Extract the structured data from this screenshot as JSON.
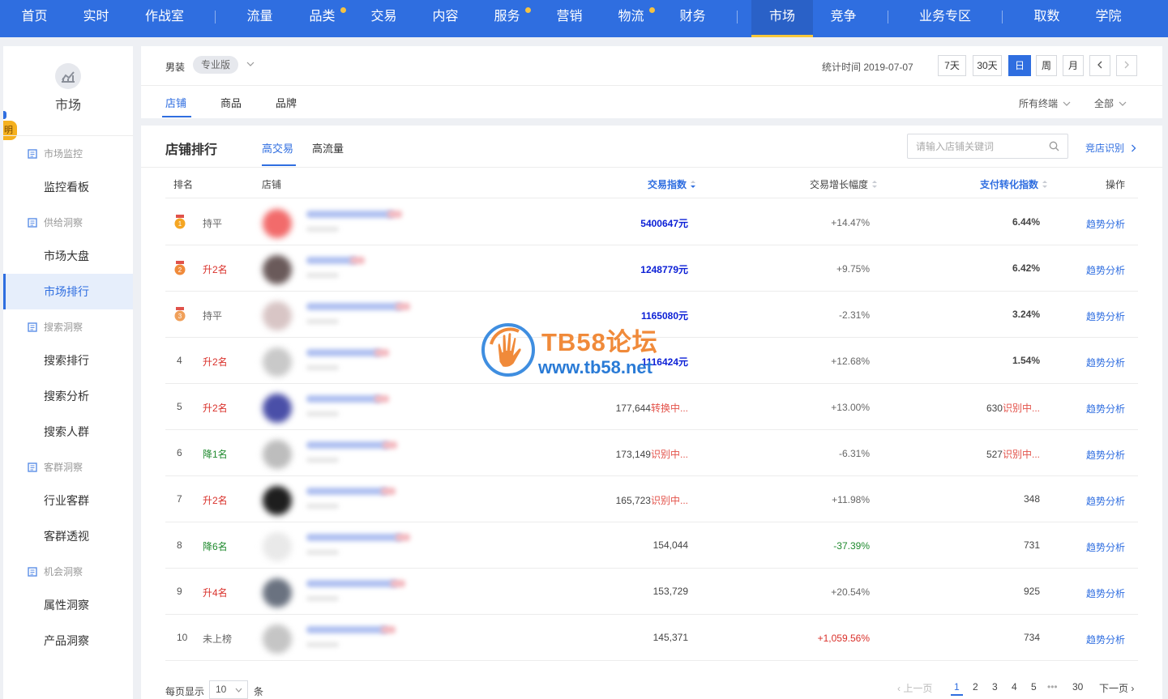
{
  "nav": {
    "items": [
      {
        "label": "首页",
        "dot": false
      },
      {
        "label": "实时",
        "dot": false
      },
      {
        "label": "作战室",
        "dot": false
      },
      {
        "label": "流量",
        "dot": false
      },
      {
        "label": "品类",
        "dot": true
      },
      {
        "label": "交易",
        "dot": false
      },
      {
        "label": "内容",
        "dot": false
      },
      {
        "label": "服务",
        "dot": true
      },
      {
        "label": "营销",
        "dot": false
      },
      {
        "label": "物流",
        "dot": true
      },
      {
        "label": "财务",
        "dot": false
      },
      {
        "label": "市场",
        "dot": false,
        "active": true
      },
      {
        "label": "竞争",
        "dot": false
      },
      {
        "label": "业务专区",
        "dot": false
      },
      {
        "label": "取数",
        "dot": false
      },
      {
        "label": "学院",
        "dot": false
      }
    ]
  },
  "sidebar": {
    "edge_tab": "明",
    "title": "市场",
    "groups": [
      {
        "label": "市场监控",
        "items": [
          "监控看板"
        ]
      },
      {
        "label": "供给洞察",
        "items": [
          "市场大盘",
          "市场排行"
        ]
      },
      {
        "label": "搜索洞察",
        "items": [
          "搜索排行",
          "搜索分析",
          "搜索人群"
        ]
      },
      {
        "label": "客群洞察",
        "items": [
          "行业客群",
          "客群透视"
        ]
      },
      {
        "label": "机会洞察",
        "items": [
          "属性洞察",
          "产品洞察"
        ]
      }
    ],
    "active_item": "市场排行"
  },
  "filter": {
    "category": "男装",
    "edition": "专业版",
    "stat_time": "统计时间 2019-07-07",
    "periods": [
      "7天",
      "30天",
      "日",
      "周",
      "月"
    ],
    "active_period": "日",
    "tabs": [
      "店铺",
      "商品",
      "品牌"
    ],
    "active_tab": "店铺",
    "terminal": "所有终端",
    "scope": "全部"
  },
  "ranking": {
    "title": "店铺排行",
    "tabs": [
      "高交易",
      "高流量"
    ],
    "active_tab": "高交易",
    "search_placeholder": "请输入店铺关键词",
    "rival_link": "竞店识别",
    "columns": [
      "排名",
      "店铺",
      "交易指数",
      "交易增长幅度",
      "支付转化指数",
      "操作"
    ],
    "rows": [
      {
        "rank": "1",
        "medal": true,
        "change": "持平",
        "change_type": "flat",
        "trade": "5400647元",
        "trade_note": "",
        "trade_hl": true,
        "growth": "+14.47%",
        "growth_type": "normal",
        "conv": "6.44%",
        "conv_note": "",
        "conv_hl": true,
        "op": "趋势分析"
      },
      {
        "rank": "2",
        "medal": true,
        "change": "升2名",
        "change_type": "up",
        "trade": "1248779元",
        "trade_note": "",
        "trade_hl": true,
        "growth": "+9.75%",
        "growth_type": "normal",
        "conv": "6.42%",
        "conv_note": "",
        "conv_hl": true,
        "op": "趋势分析"
      },
      {
        "rank": "3",
        "medal": true,
        "change": "持平",
        "change_type": "flat",
        "trade": "1165080元",
        "trade_note": "",
        "trade_hl": true,
        "growth": "-2.31%",
        "growth_type": "normal",
        "conv": "3.24%",
        "conv_note": "",
        "conv_hl": true,
        "op": "趋势分析"
      },
      {
        "rank": "4",
        "medal": false,
        "change": "升2名",
        "change_type": "up",
        "trade": "1116424元",
        "trade_note": "",
        "trade_hl": true,
        "growth": "+12.68%",
        "growth_type": "normal",
        "conv": "1.54%",
        "conv_note": "",
        "conv_hl": true,
        "op": "趋势分析"
      },
      {
        "rank": "5",
        "medal": false,
        "change": "升2名",
        "change_type": "up",
        "trade": "177,644",
        "trade_note": "转换中...",
        "trade_hl": false,
        "growth": "+13.00%",
        "growth_type": "normal",
        "conv": "630",
        "conv_note": "识别中...",
        "conv_hl": false,
        "op": "趋势分析"
      },
      {
        "rank": "6",
        "medal": false,
        "change": "降1名",
        "change_type": "down",
        "trade": "173,149",
        "trade_note": "识别中...",
        "trade_hl": false,
        "growth": "-6.31%",
        "growth_type": "normal",
        "conv": "527",
        "conv_note": "识别中...",
        "conv_hl": false,
        "op": "趋势分析"
      },
      {
        "rank": "7",
        "medal": false,
        "change": "升2名",
        "change_type": "up",
        "trade": "165,723",
        "trade_note": "识别中...",
        "trade_hl": false,
        "growth": "+11.98%",
        "growth_type": "normal",
        "conv": "348",
        "conv_note": "",
        "conv_hl": false,
        "op": "趋势分析"
      },
      {
        "rank": "8",
        "medal": false,
        "change": "降6名",
        "change_type": "down",
        "trade": "154,044",
        "trade_note": "",
        "trade_hl": false,
        "growth": "-37.39%",
        "growth_type": "green",
        "conv": "731",
        "conv_note": "",
        "conv_hl": false,
        "op": "趋势分析"
      },
      {
        "rank": "9",
        "medal": false,
        "change": "升4名",
        "change_type": "up",
        "trade": "153,729",
        "trade_note": "",
        "trade_hl": false,
        "growth": "+20.54%",
        "growth_type": "normal",
        "conv": "925",
        "conv_note": "",
        "conv_hl": false,
        "op": "趋势分析"
      },
      {
        "rank": "10",
        "medal": false,
        "change": "未上榜",
        "change_type": "flat",
        "trade": "145,371",
        "trade_note": "",
        "trade_hl": false,
        "growth": "+1,059.56%",
        "growth_type": "red",
        "conv": "734",
        "conv_note": "",
        "conv_hl": false,
        "op": "趋势分析"
      }
    ]
  },
  "pagination": {
    "per_page_label": "每页显示",
    "per_page_value": "10",
    "per_page_unit": "条",
    "prev": "上一页",
    "pages": [
      "1",
      "2",
      "3",
      "4",
      "5",
      "•••",
      "30"
    ],
    "current": "1",
    "next": "下一页"
  },
  "watermark": {
    "line1": "TB58论坛",
    "line2": "www.tb58.net"
  },
  "colors": {
    "brand": "#2f6ee0",
    "highlight": "#0b1fd6",
    "up": "#d9302a",
    "down": "#1f8a2e"
  }
}
